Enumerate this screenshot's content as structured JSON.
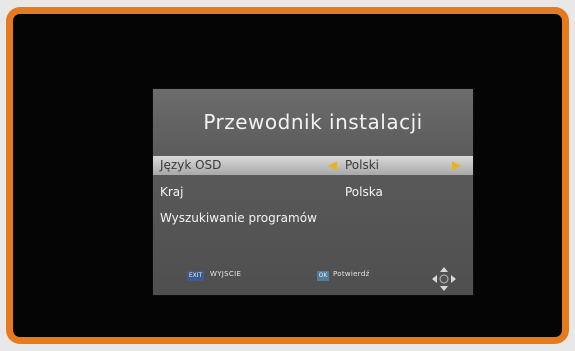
{
  "dialog": {
    "title": "Przewodnik instalacji",
    "items": [
      {
        "label": "Język OSD",
        "value": "Polski",
        "selected": true
      },
      {
        "label": "Kraj",
        "value": "Polska",
        "selected": false
      },
      {
        "label": "Wyszukiwanie programów",
        "value": "",
        "selected": false
      }
    ]
  },
  "footer": {
    "exit_key": "EXIT",
    "exit_label": "WYJSCIE",
    "ok_key": "OK",
    "ok_label": "Potwierdź"
  },
  "icons": {
    "left_arrow": "arrow-left-icon",
    "right_arrow": "arrow-right-icon",
    "navigation": "dpad-icon"
  },
  "colors": {
    "frame": "#e87a1e",
    "background": "#050505",
    "dialog": "#5a5a5a",
    "highlight": "#c0c0c0",
    "arrow": "#e9b417"
  }
}
